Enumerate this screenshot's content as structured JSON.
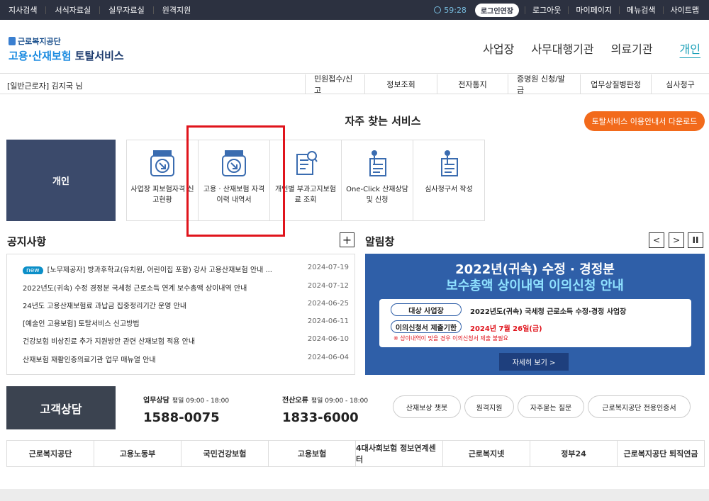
{
  "topbar": {
    "left": [
      "지사검색",
      "서식자료실",
      "실무자료실",
      "원격지원"
    ],
    "timer": "59:28",
    "extend": "로그인연장",
    "right": [
      "로그아웃",
      "마이페이지",
      "메뉴검색",
      "사이트맵"
    ]
  },
  "header": {
    "org": "근로복지공단",
    "service_a": "고용·산재보험",
    "service_b": " 토탈서비스",
    "gnb": [
      "사업장",
      "사무대행기관",
      "의료기관",
      "개인"
    ]
  },
  "subbar": {
    "user": "[일반근로자] 김지국 님",
    "menu": [
      "민원접수/신고",
      "정보조회",
      "전자통지",
      "증명원 신청/발급",
      "업무상질병판정",
      "심사청구"
    ]
  },
  "services": {
    "title": "자주 찾는 서비스",
    "download": "토탈서비스 이용안내서 다운로드",
    "category": "개인",
    "tiles": [
      "사업장 피보험자격 신고현황",
      "고용 · 산재보험 자격 이력 내역서",
      "개인별 부과고지보험료 조회",
      "One-Click 산재상담 및 신청",
      "심사청구서 작성"
    ]
  },
  "notice": {
    "title": "공지사항",
    "plus": "+",
    "badge": "new",
    "items": [
      {
        "t": "[노무제공자] 방과후학교(유치원, 어린이집 포함) 강사 고용산재보험 안내 ...",
        "d": "2024-07-19"
      },
      {
        "t": "2022년도(귀속) 수정 경정분 국세청 근로소득 연계 보수총액 상이내역 안내",
        "d": "2024-07-12"
      },
      {
        "t": "24년도 고용산재보험료 과납금 집중정리기간 운영 안내",
        "d": "2024-06-25"
      },
      {
        "t": "[예술인 고용보험] 토탈서비스 신고방법",
        "d": "2024-06-11"
      },
      {
        "t": "건강보험 비상진료 추가 지원방안 관련 산재보험 적용 안내",
        "d": "2024-06-10"
      },
      {
        "t": "산재보험 재활인증의료기관 업무 매뉴얼 안내",
        "d": "2024-06-04"
      }
    ]
  },
  "alarm": {
    "title": "알림창",
    "prev": "<",
    "next": ">",
    "pause": "II",
    "line1": "2022년(귀속) 수정 · 경정분",
    "line2": "보수총액 상이내역 이의신청 안내",
    "p1": "대상 사업장",
    "v1": "2022년도(귀속) 국세청 근로소득 수정·경정 사업장",
    "p2": "이의신청서 제출기한",
    "v2": "2024년 7월 26일(금)",
    "warn": "※ 상이내역이 맞을 경우 이의신청서 제출 불필요",
    "more": "자세히 보기  >"
  },
  "cs": {
    "title": "고객상담",
    "a_head": "업무상담",
    "a_hours": "평일 09:00 - 18:00",
    "a_num": "1588-0075",
    "b_head": "전산오류",
    "b_hours": "평일 09:00 - 18:00",
    "b_num": "1833-6000",
    "links": [
      "산재보상 챗봇",
      "원격지원",
      "자주묻는 질문",
      "근로복지공단 전용인증서"
    ]
  },
  "banners": [
    "근로복지공단",
    "고용노동부",
    "국민건강보험",
    "고용보험",
    "4대사회보험 정보연계센터",
    "근로복지넷",
    "정부24",
    "근로복지공단 퇴직연금"
  ]
}
